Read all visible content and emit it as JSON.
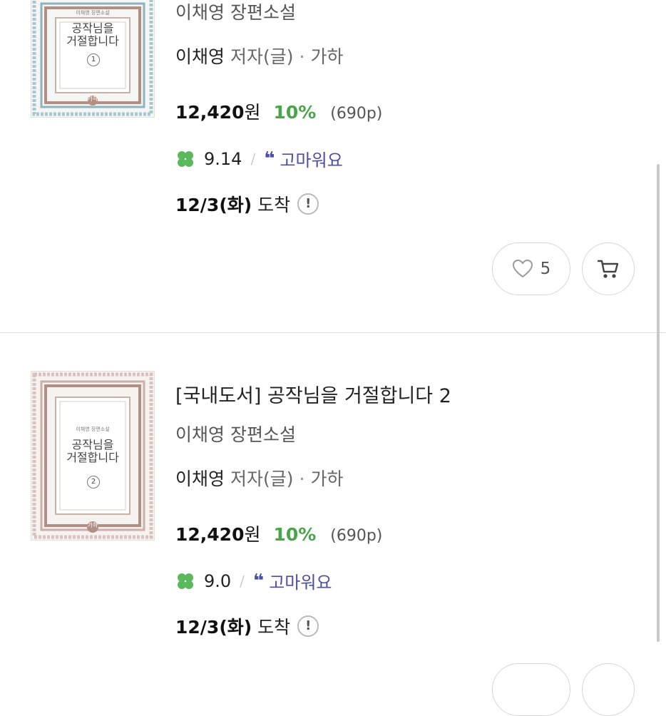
{
  "colors": {
    "discount_green": "#4aa548",
    "review_blue": "#4b4fa6",
    "clover_green": "#5cb85c"
  },
  "items": [
    {
      "title": "",
      "subtitle": "이채영 장편소설",
      "author": "이채영",
      "author_role": "저자(글)",
      "separator": "·",
      "publisher": "가하",
      "price": "12,420",
      "currency": "원",
      "discount": "10%",
      "pages": "(690p)",
      "rating_icon": "clover-icon",
      "rating": "9.14",
      "rating_separator": "/",
      "review_icon": "quote-icon",
      "review_label": "고마워요",
      "delivery_date": "12/3(화)",
      "delivery_label": "도착",
      "info_icon": "!",
      "like_count": "5",
      "cover": {
        "series_text": "이채영 장편소설",
        "title_line1": "공작님을",
        "title_line2": "거절합니다",
        "volume": "1",
        "publisher_mark": "가하"
      }
    },
    {
      "title": "[국내도서] 공작님을 거절합니다 2",
      "subtitle": "이채영 장편소설",
      "author": "이채영",
      "author_role": "저자(글)",
      "separator": "·",
      "publisher": "가하",
      "price": "12,420",
      "currency": "원",
      "discount": "10%",
      "pages": "(690p)",
      "rating_icon": "clover-icon",
      "rating": "9.0",
      "rating_separator": "/",
      "review_icon": "quote-icon",
      "review_label": "고마워요",
      "delivery_date": "12/3(화)",
      "delivery_label": "도착",
      "info_icon": "!",
      "cover": {
        "series_text": "이채영 장편소설",
        "title_line1": "공작님을",
        "title_line2": "거절합니다",
        "volume": "2",
        "publisher_mark": "가하"
      }
    }
  ]
}
